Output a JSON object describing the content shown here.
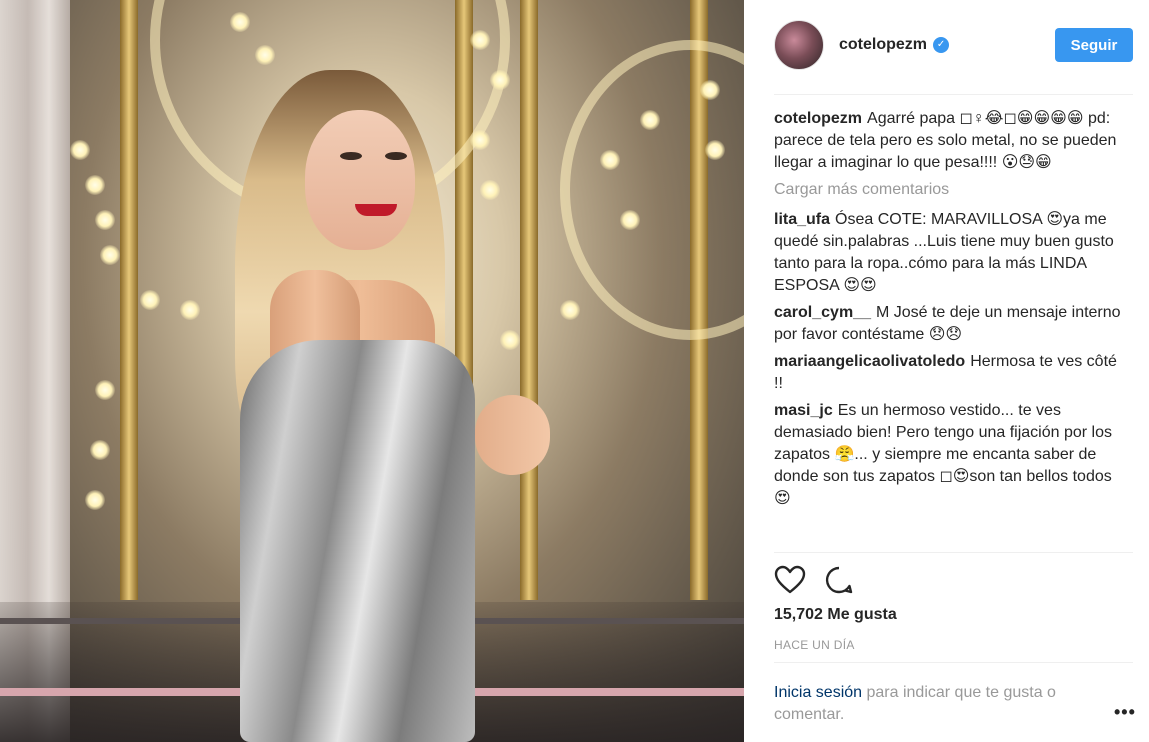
{
  "post": {
    "username": "cotelopezm",
    "verified_mark": "✓",
    "follow_label": "Seguir",
    "caption": {
      "username": "cotelopezm",
      "text": "Agarré papa ◻♀😂◻😁😁😁😁 pd: parece de tela pero es solo metal, no se pueden llegar a imaginar lo que pesa!!!! 😮😓😁"
    },
    "load_more_label": "Cargar más comentarios",
    "comments": [
      {
        "username": "lita_ufa",
        "text": "Ósea COTE: MARAVILLOSA 😍ya me quedé sin.palabras ...Luis tiene muy buen gusto tanto para la ropa..cómo para la más LINDA ESPOSA 😍😍"
      },
      {
        "username": "carol_cym__",
        "text": "M José te deje un mensaje interno por favor contéstame 😞😞"
      },
      {
        "username": "mariaangelicaolivatoledo",
        "text": "Hermosa te ves côté !!"
      },
      {
        "username": "masi_jc",
        "text": "Es un hermoso vestido... te ves demasiado bien! Pero tengo una fijación por los zapatos 😤... y siempre me encanta saber de donde son tus zapatos ◻😍son tan bellos todos 😍"
      }
    ],
    "likes_label": "15,702 Me gusta",
    "timestamp": "HACE UN DÍA",
    "login_link": "Inicia sesión",
    "login_rest": " para indicar que te gusta o comentar.",
    "more_label": "•••",
    "icons": {
      "like": "heart-icon",
      "comment": "comment-icon"
    },
    "colors": {
      "accent": "#3897f0",
      "muted": "#999999",
      "text": "#262626",
      "link": "#003569"
    }
  }
}
